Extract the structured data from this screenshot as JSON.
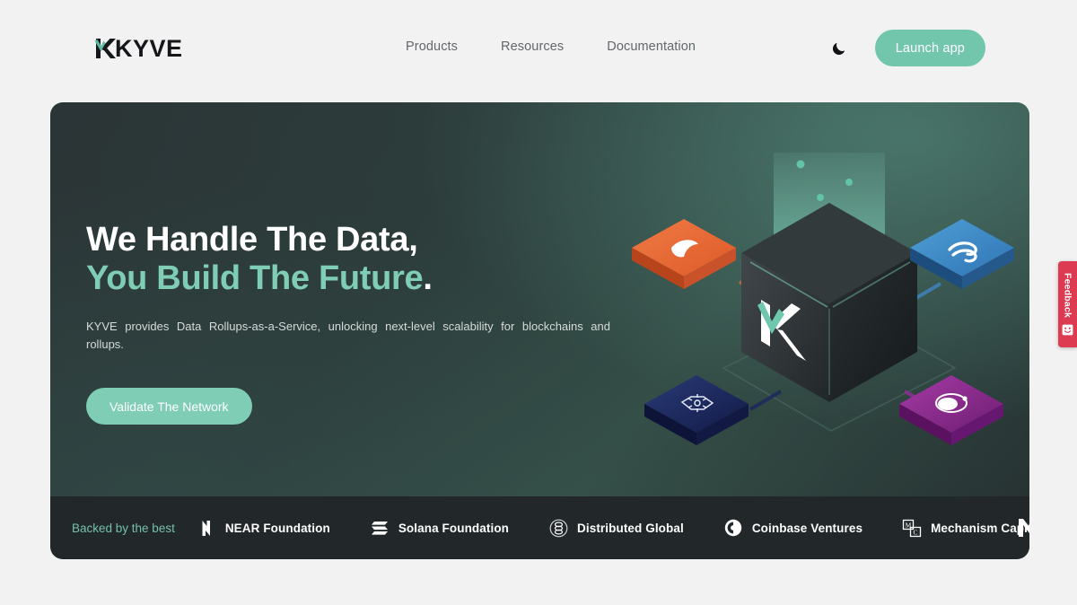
{
  "brand": {
    "logo_text": "KYVE",
    "logo_icon": "kyve-k-mark",
    "accent_color": "#7fcdb4",
    "accent_button_color": "#72c6ab"
  },
  "header": {
    "nav": [
      {
        "label": "Products"
      },
      {
        "label": "Resources"
      },
      {
        "label": "Documentation"
      }
    ],
    "theme_toggle_icon": "moon-icon",
    "launch_label": "Launch app"
  },
  "hero": {
    "heading_line1": "We Handle The Data,",
    "heading_line2": "You Build The Future",
    "heading_period": ".",
    "subtitle": "KYVE provides Data Rollups-as-a-Service, unlocking next-level scalability for blockchains and rollups.",
    "cta_label": "Validate The Network",
    "illustration": "isometric-kyve-cube-with-chain-tiles"
  },
  "partners": {
    "intro": "Backed by the best",
    "items": [
      {
        "name": "NEAR Foundation",
        "icon": "near-icon"
      },
      {
        "name": "Solana Foundation",
        "icon": "solana-icon"
      },
      {
        "name": "Distributed Global",
        "icon": "distributed-global-icon"
      },
      {
        "name": "Coinbase Ventures",
        "icon": "coinbase-icon"
      },
      {
        "name": "Mechanism Capital",
        "icon": "mechanism-capital-icon"
      }
    ],
    "overflow_icon": "partner-logo-partial"
  },
  "feedback": {
    "label": "Feedback",
    "icon": "smiley-feedback-icon",
    "color": "#dc3b52"
  }
}
